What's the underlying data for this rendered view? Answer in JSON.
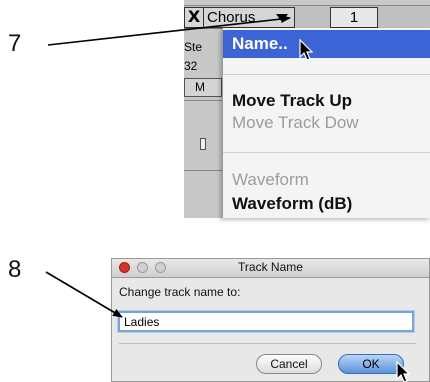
{
  "steps": {
    "top": "7",
    "bottom": "8"
  },
  "track_panel": {
    "close_symbol": "X",
    "track_name": "Chorus",
    "zoom_value": "1",
    "side_labels": [
      "Ste",
      "32"
    ],
    "mute_label": "M"
  },
  "menu": {
    "items": [
      {
        "label": "Name..",
        "state": "highlighted"
      },
      {
        "label": "Move Track Up",
        "state": "enabled"
      },
      {
        "label": "Move Track Dow",
        "state": "disabled"
      },
      {
        "label": "Waveform",
        "state": "disabled"
      },
      {
        "label": "Waveform (dB)",
        "state": "enabled"
      }
    ],
    "highlight_color": "#3c64d4"
  },
  "dialog": {
    "title": "Track Name",
    "prompt": "Change track name to:",
    "input_value": "Ladies",
    "cancel_label": "Cancel",
    "ok_label": "OK"
  },
  "icons": [
    "close-icon",
    "dropdown-arrow-icon",
    "pointer-cursor-icon",
    "window-close-icon",
    "window-minimize-icon",
    "window-zoom-icon"
  ]
}
